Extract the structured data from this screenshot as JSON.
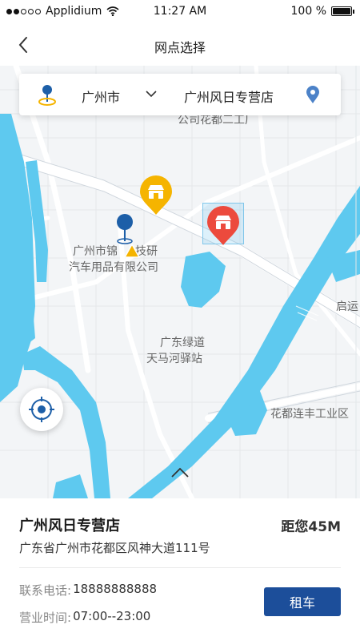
{
  "status_bar": {
    "carrier": "Applidium",
    "time": "11:27 AM",
    "battery_text": "100 %",
    "battery_level": 1.0
  },
  "nav": {
    "title": "网点选择",
    "back_icon": "chevron-left-icon"
  },
  "search": {
    "city": "广州市",
    "store": "广州风日专营店",
    "left_icon": "location-pin-icon",
    "right_icon": "map-pin-icon"
  },
  "map": {
    "labels": [
      "公司花都二工厂",
      "广州市锦",
      "技研",
      "汽车用品有限公司",
      "广东绿道",
      "天马河驿站",
      "花都连丰工业区",
      "启运"
    ]
  },
  "store": {
    "name": "广州风日专营店",
    "distance": "距您45M",
    "address": "广东省广州市花都区风神大道111号",
    "phone_label": "联系电话:",
    "phone": "18888888888",
    "hours_label": "营业时间:",
    "hours": "07:00--23:00",
    "rent_label": "租车"
  },
  "colors": {
    "accent": "#1c4e9a",
    "water": "#5ec9ef",
    "marker_yellow": "#f5b400",
    "marker_red": "#ec4a3d",
    "pin_blue": "#1d5fa8"
  }
}
